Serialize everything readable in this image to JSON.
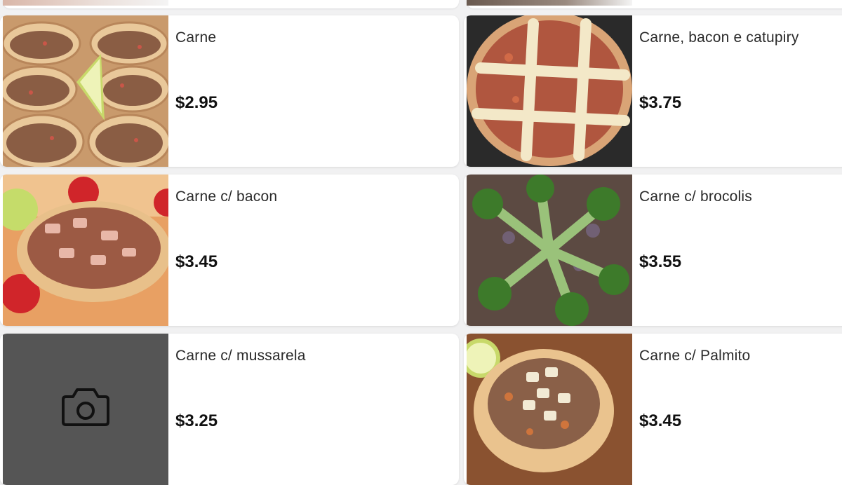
{
  "menu": {
    "items": [
      {
        "name": "Carne",
        "price": "$2.95",
        "image": "meat-esfiha-photo"
      },
      {
        "name": "Carne, bacon e catupiry",
        "price": "$3.75",
        "image": "lattice-cheese-esfiha-photo"
      },
      {
        "name": "Carne c/ bacon",
        "price": "$3.45",
        "image": "bacon-esfiha-photo"
      },
      {
        "name": "Carne c/ brocolis",
        "price": "$3.55",
        "image": "broccoli-esfiha-photo"
      },
      {
        "name": "Carne c/ mussarela",
        "price": "$3.25",
        "image": "camera-icon"
      },
      {
        "name": "Carne c/ Palmito",
        "price": "$3.45",
        "image": "palmito-esfiha-photo"
      }
    ]
  },
  "colors": {
    "page_background": "#f1f1f2",
    "card_background": "#ffffff",
    "placeholder_background": "#555555",
    "price_text": "#111111"
  }
}
